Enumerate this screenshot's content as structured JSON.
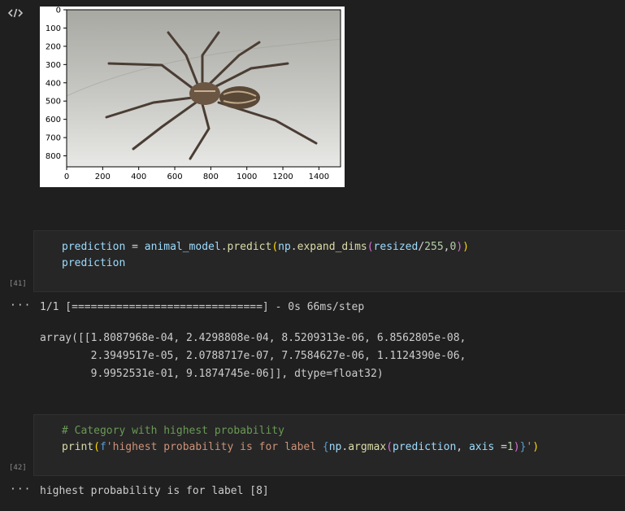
{
  "toolbar": {
    "icon": "code-brackets-icon"
  },
  "figure": {
    "y_ticks": [
      "0",
      "100",
      "200",
      "300",
      "400",
      "500",
      "600",
      "700",
      "800"
    ],
    "x_ticks": [
      "0",
      "200",
      "400",
      "600",
      "800",
      "1000",
      "1200",
      "1400"
    ],
    "image_subject": "wolf spider on white surface"
  },
  "cells": [
    {
      "exec_count": "[41]",
      "code": {
        "line1": {
          "v1": "prediction",
          "eq": " = ",
          "v2": "animal_model",
          "d1": ".",
          "f1": "predict",
          "p1": "(",
          "v3": "np",
          "d2": ".",
          "f2": "expand_dims",
          "p2": "(",
          "v4": "resized",
          "sl": "/",
          "n1": "255",
          "cm": ",",
          "n2": "0",
          "p3": ")",
          "p4": ")"
        },
        "line2": "prediction"
      },
      "output": {
        "progress_line": "1/1 [==============================] - 0s 66ms/step",
        "array_lines": [
          "array([[1.8087968e-04, 2.4298808e-04, 8.5209313e-06, 6.8562805e-08,",
          "        2.3949517e-05, 2.0788717e-07, 7.7584627e-06, 1.1124390e-06,",
          "        9.9952531e-01, 9.1874745e-06]], dtype=float32)"
        ]
      }
    },
    {
      "exec_count": "[42]",
      "code": {
        "comment": "# Category with highest probability",
        "line2": {
          "f1": "print",
          "p1": "(",
          "fp": "f",
          "s1": "'highest probability is for label ",
          "b1": "{",
          "v1": "np",
          "d1": ".",
          "f2": "argmax",
          "p2": "(",
          "v2": "prediction",
          "cm": ", ",
          "v3": "axis",
          "eq": " =",
          "n1": "1",
          "p3": ")",
          "b2": "}",
          "s2": "'",
          "p4": ")"
        }
      },
      "output": {
        "text": "highest probability is for label [8]"
      }
    }
  ],
  "ellipsis": "···",
  "colors": {
    "background": "#1f1f1f",
    "cell": "#262626",
    "variable": "#9cdcfe",
    "function": "#dcdcaa",
    "number": "#b5cea8",
    "string": "#ce9178",
    "comment": "#6a9955"
  }
}
